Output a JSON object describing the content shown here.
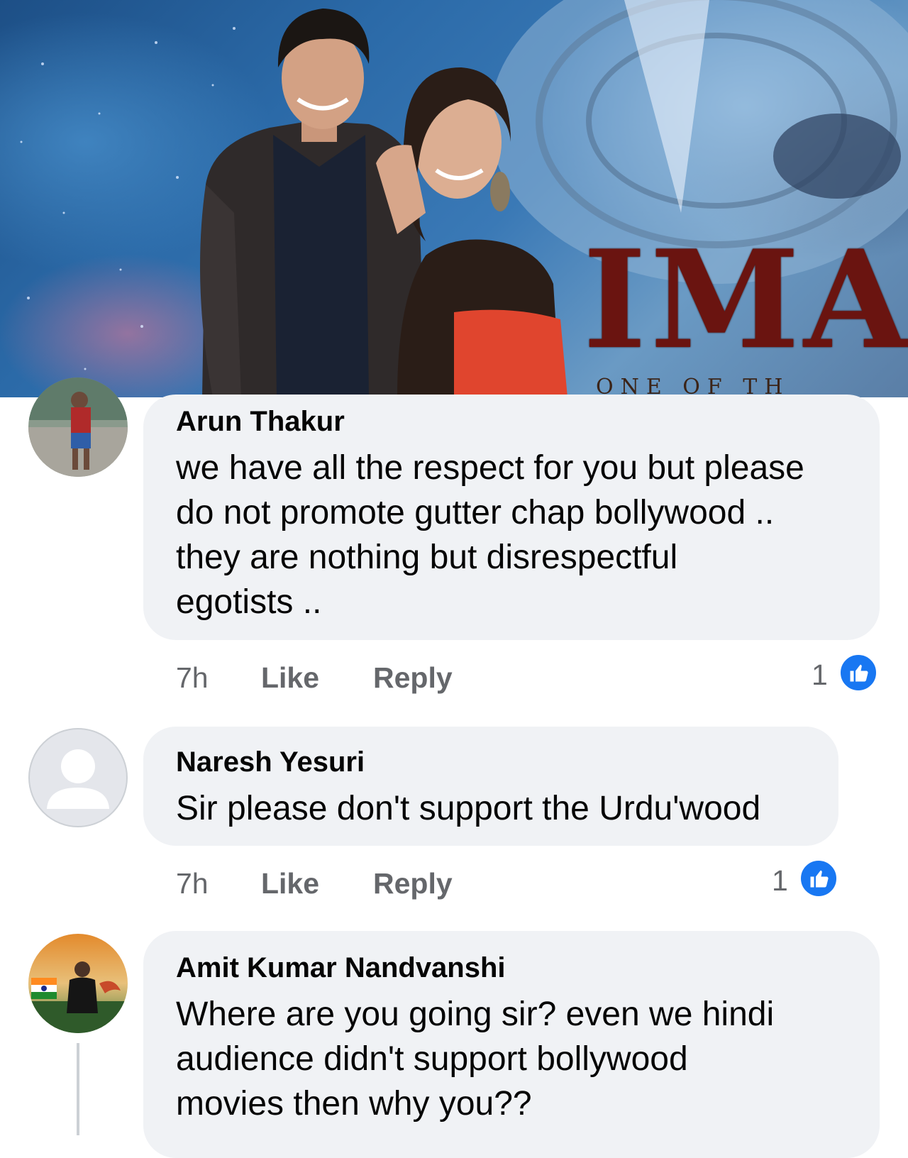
{
  "photo": {
    "description_icon": "event-photo",
    "poster_title": "IMAS",
    "poster_tagline": "ONE OF TH"
  },
  "comments": [
    {
      "author": "Arun Thakur",
      "avatar_icon": "user-photo-avatar",
      "text_lines": [
        "we have all the respect for you but please",
        "do not promote gutter chap bollywood ..",
        "they are nothing but disrespectful",
        "egotists .."
      ],
      "time": "7h",
      "like_label": "Like",
      "reply_label": "Reply",
      "reaction_count": "1",
      "reaction_icon": "thumbs-up-icon"
    },
    {
      "author": "Naresh Yesuri",
      "avatar_icon": "default-avatar",
      "text_lines": [
        "Sir please don't support the Urdu'wood"
      ],
      "time": "7h",
      "like_label": "Like",
      "reply_label": "Reply",
      "reaction_count": "1",
      "reaction_icon": "thumbs-up-icon"
    },
    {
      "author": "Amit Kumar Nandvanshi",
      "avatar_icon": "user-photo-avatar",
      "text_lines": [
        "Where are you going sir? even we hindi",
        "audience didn't support bollywood",
        "movies then why you??"
      ]
    }
  ],
  "colors": {
    "bubble": "#f0f2f5",
    "meta_text": "#65676b",
    "like_blue": "#1877f2"
  }
}
